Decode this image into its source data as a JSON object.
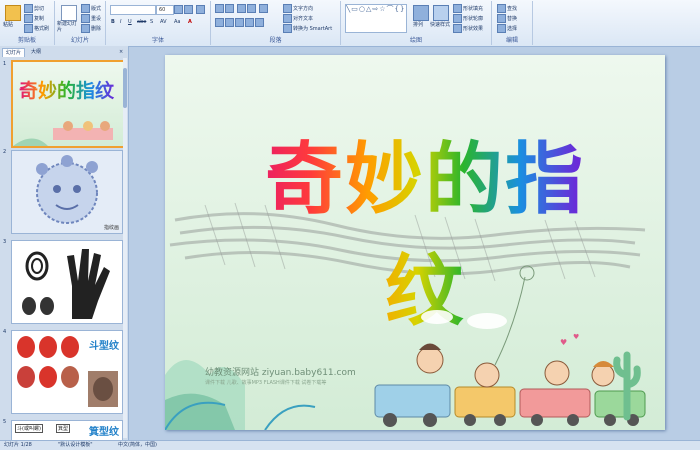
{
  "ribbon": {
    "clipboard": {
      "paste": "粘贴",
      "cut": "剪切",
      "copy": "复制",
      "format_painter": "格式刷",
      "label": "剪贴板"
    },
    "slides": {
      "new_slide": "新建幻灯片",
      "layout": "版式",
      "reset": "重设",
      "delete": "删除",
      "label": "幻灯片"
    },
    "font": {
      "font_size": "60",
      "bold": "B",
      "italic": "I",
      "underline": "U",
      "strike": "abe",
      "shadow": "S",
      "spacing": "AV",
      "case": "Aa",
      "color": "A",
      "label": "字体"
    },
    "paragraph": {
      "text_direction": "文字方向",
      "align_text": "对齐文本",
      "smartart": "转换为 SmartArt",
      "label": "段落"
    },
    "drawing": {
      "arrange": "排列",
      "quick_styles": "快速样式",
      "shape_fill": "形状填充",
      "shape_outline": "形状轮廓",
      "shape_effects": "形状效果",
      "label": "绘图"
    },
    "editing": {
      "find": "查找",
      "replace": "替换",
      "select": "选择",
      "label": "编辑"
    }
  },
  "panel": {
    "tab_slides": "幻灯片",
    "tab_outline": "大纲",
    "thumbnails": [
      {
        "num": "1",
        "caption": "奇妙的指纹"
      },
      {
        "num": "2",
        "caption": "指纹画"
      },
      {
        "num": "3",
        "caption": ""
      },
      {
        "num": "4",
        "caption": "斗型纹"
      },
      {
        "num": "5",
        "caption": "箕型纹"
      }
    ],
    "thumb5_small": "斗(或叫螺)",
    "thumb5_small2": "箕型"
  },
  "slide": {
    "title": "奇妙的指纹",
    "footer": "幼教资源网站  ziyuan.baby611.com",
    "footer_sub": "课件下载  儿歌、故事MP3  FLASH课件下载  试卷下载等"
  },
  "status": {
    "slide_info": "幻灯片 1/28",
    "theme": "\"默认设计模板\"",
    "language": "中文(简体，中国)"
  }
}
